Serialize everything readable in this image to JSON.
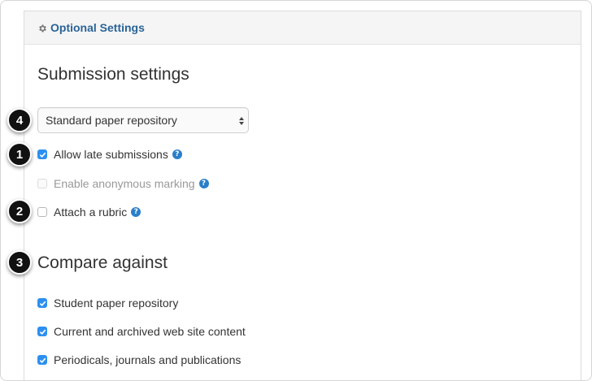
{
  "panel": {
    "title": "Optional Settings",
    "icon": "gear-icon"
  },
  "submission": {
    "heading": "Submission settings",
    "repository_select": {
      "selected": "Standard paper repository"
    },
    "options": [
      {
        "label": "Allow late submissions",
        "checked": true,
        "disabled": false,
        "help": true
      },
      {
        "label": "Enable anonymous marking",
        "checked": false,
        "disabled": true,
        "help": true
      },
      {
        "label": "Attach a rubric",
        "checked": false,
        "disabled": false,
        "help": true
      }
    ]
  },
  "compare": {
    "heading": "Compare against",
    "options": [
      {
        "label": "Student paper repository",
        "checked": true
      },
      {
        "label": "Current and archived web site content",
        "checked": true
      },
      {
        "label": "Periodicals, journals and publications",
        "checked": true
      }
    ]
  },
  "callouts": [
    "4",
    "1",
    "2",
    "3"
  ],
  "colors": {
    "accent": "#2d8ff0",
    "link": "#2a6496",
    "help_icon": "#2a7fc9",
    "callout": "#111111"
  }
}
